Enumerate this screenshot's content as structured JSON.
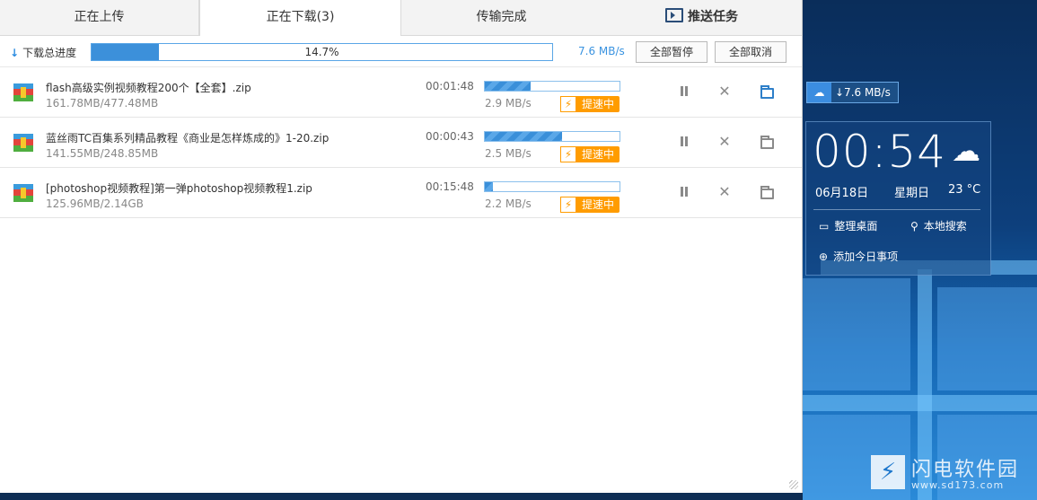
{
  "tabs": [
    {
      "label": "正在上传"
    },
    {
      "label": "正在下载(3)"
    },
    {
      "label": "传输完成"
    },
    {
      "label": "推送任务",
      "icon": "push-screen-icon"
    }
  ],
  "summary": {
    "label": "下载总进度",
    "percent_text": "14.7%",
    "progress": 0.147,
    "speed": "7.6 MB/s",
    "pause_all": "全部暂停",
    "cancel_all": "全部取消"
  },
  "downloads": [
    {
      "name": "flash高级实例视频教程200个【全套】.zip",
      "size": "161.78MB/477.48MB",
      "time": "00:01:48",
      "progress": 0.34,
      "speed": "2.9 MB/s",
      "boost": "提速中"
    },
    {
      "name": "蓝丝雨TC百集系列精品教程《商业是怎样炼成的》1-20.zip",
      "size": "141.55MB/248.85MB",
      "time": "00:00:43",
      "progress": 0.57,
      "speed": "2.5 MB/s",
      "boost": "提速中"
    },
    {
      "name": "[photoshop视频教程]第一弹photoshop视频教程1.zip",
      "size": "125.96MB/2.14GB",
      "time": "00:15:48",
      "progress": 0.06,
      "speed": "2.2 MB/s",
      "boost": "提速中"
    }
  ],
  "float_badge": {
    "speed": "↓7.6 MB/s"
  },
  "widget": {
    "time": "00:54",
    "date": "06月18日",
    "weekday": "星期日",
    "temp": "23 °C",
    "tidy_desktop": "整理桌面",
    "local_search": "本地搜索",
    "add_today": "添加今日事项"
  },
  "watermark": {
    "text": "闪电软件园",
    "url": "www.sd173.com"
  },
  "colors": {
    "accent": "#3c90da",
    "boost": "#ff9c00",
    "folder_active": "#2e7fc9"
  }
}
